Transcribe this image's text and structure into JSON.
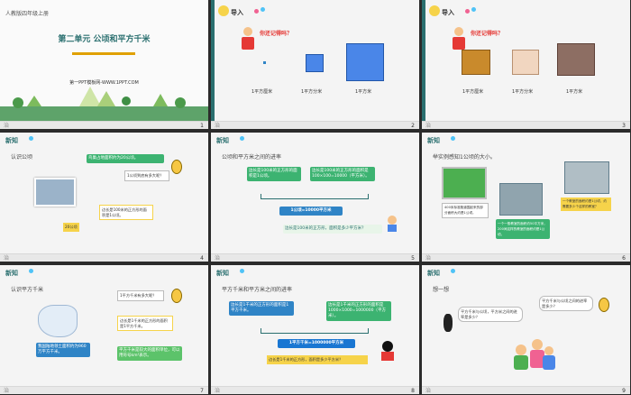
{
  "slides": [
    {
      "number": "1",
      "grade": "人教版四年级上册",
      "title": "第二单元  公顷和平方千米",
      "site": "第一PPT模板网-WWW.1PPT.COM",
      "foot_mark": "治"
    },
    {
      "number": "2",
      "header": "导入",
      "question": "你还记得吗？",
      "labels": [
        "1平方厘米",
        "1平方分米",
        "1平方米"
      ],
      "foot_mark": "治"
    },
    {
      "number": "3",
      "header": "导入",
      "question": "你还记得吗？",
      "labels": [
        "1平方厘米",
        "1平方分米",
        "1平方米"
      ],
      "foot_mark": "治"
    },
    {
      "number": "4",
      "header": "新知",
      "subtitle": "认识公顷",
      "note1": "鸟巢占地面积约为20公顷。",
      "note2": "1公顷到底有多大呢？",
      "note3": "边长是100米的正方形的面积是1公顷。",
      "badge": "20公顷",
      "foot_mark": "治"
    },
    {
      "number": "5",
      "header": "新知",
      "subtitle": "公顷和平方米之间的进率",
      "box1": "边长是100米的正方形的面积是1公顷。",
      "box2": "边长是100米的正方形的面积是100×100=10000（平方米）。",
      "equation": "1公顷=10000平方米",
      "question": "边长是100米的正方形，面积是多少平方米？",
      "foot_mark": "治"
    },
    {
      "number": "6",
      "header": "新知",
      "subtitle": "举实例感知1公顷的大小。",
      "cap1": "400米标准跑道围起来的部分面积大约是1公顷。",
      "cap2": "一个一般教室的面积约50平方米，200间这样的教室的面积约是1公顷。",
      "cap3": "一个教室的面积约是1公顷，约需要多少个这样的教室？",
      "foot_mark": "治"
    },
    {
      "number": "7",
      "header": "新知",
      "subtitle": "认识平方千米",
      "note1": "1平方千米有多大呢？",
      "note2": "我国陆地领土面积约为960万平方千米。",
      "note3": "边长是1千米的正方形的面积是1平方千米。",
      "note4": "平方千米是较大的面积单位，可以用符号km²表示。",
      "foot_mark": "治"
    },
    {
      "number": "8",
      "header": "新知",
      "subtitle": "平方千米和平方米之间的进率",
      "box1": "边长是1千米的正方形的面积是1平方千米。",
      "box2": "边长是1千米的正方形的面积是1000×1000=1000000（平方米）。",
      "equation": "1平方千米=1000000平方米",
      "question": "边长是1千米的正方形，面积是多少平方米？",
      "foot_mark": "治"
    },
    {
      "number": "9",
      "header": "新知",
      "subtitle": "想一想",
      "bubble1": "平方千米与公顷，平方米之间的进率是多少？",
      "bubble2": "平方千米与公顷之间的进率是多少？",
      "foot_mark": "治"
    }
  ],
  "colors": {
    "teal": "#2a6f6f",
    "green": "#3cb371",
    "blue": "#2f84c6",
    "yellow": "#f6d34a",
    "red": "#e53935"
  }
}
